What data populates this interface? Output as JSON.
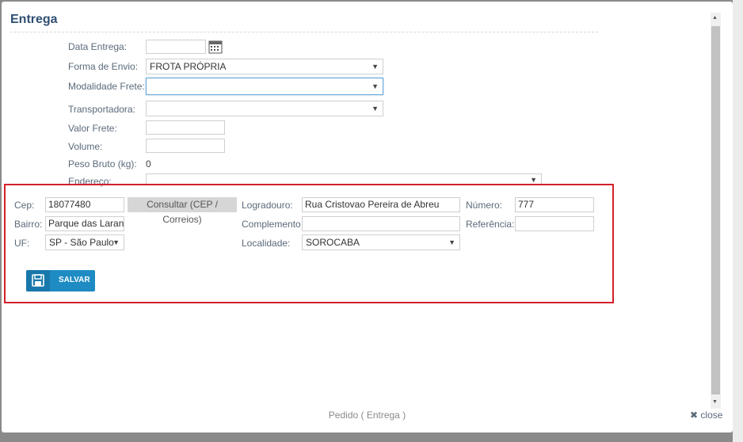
{
  "modal": {
    "title": "Entrega"
  },
  "form": {
    "data_entrega": {
      "label": "Data Entrega:",
      "value": ""
    },
    "forma_envio": {
      "label": "Forma de Envio:",
      "value": "FROTA PRÓPRIA"
    },
    "modalidade_frete": {
      "label": "Modalidade Frete:",
      "value": ""
    },
    "transportadora": {
      "label": "Transportadora:",
      "value": ""
    },
    "valor_frete": {
      "label": "Valor Frete:",
      "value": ""
    },
    "volume": {
      "label": "Volume:",
      "value": ""
    },
    "peso_bruto": {
      "label": "Peso Bruto (kg):",
      "value": "0"
    },
    "endereco": {
      "label": "Endereço:",
      "value": ""
    }
  },
  "address": {
    "cep": {
      "label": "Cep:",
      "value": "18077480"
    },
    "consultar_button": "Consultar (CEP / Correios)",
    "logradouro": {
      "label": "Logradouro:",
      "value": "Rua Cristovao Pereira de Abreu"
    },
    "numero": {
      "label": "Número:",
      "value": "777"
    },
    "bairro": {
      "label": "Bairro:",
      "value": "Parque das Laranjeiras"
    },
    "complemento": {
      "label": "Complemento",
      "value": ""
    },
    "referencia": {
      "label": "Referência:",
      "value": ""
    },
    "uf": {
      "label": "UF:",
      "value": "SP - São Paulo"
    },
    "localidade": {
      "label": "Localidade:",
      "value": "SOROCABA"
    },
    "salvar_button": "SALVAR"
  },
  "footer": {
    "text": "Pedido ( Entrega )",
    "close_label": "close"
  },
  "icons": {
    "calendar": "calendar-icon",
    "save": "floppy-disk-icon",
    "close": "close-x-icon",
    "dropdown": "chevron-down-icon"
  },
  "colors": {
    "title": "#2f4f73",
    "highlight_box": "#d4202a",
    "primary_button": "#1e8bc3"
  }
}
